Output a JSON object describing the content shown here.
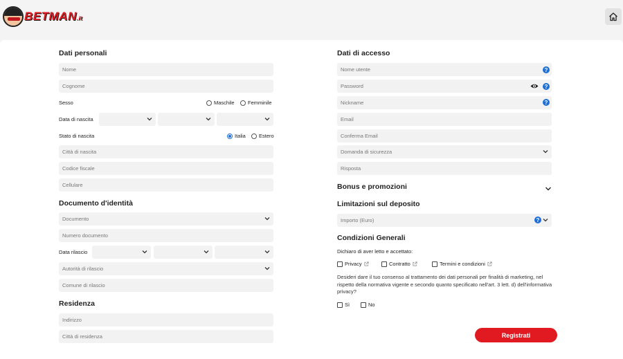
{
  "brand": {
    "name": "BETMAN",
    "suffix": ".it"
  },
  "left": {
    "personal_title": "Dati personali",
    "nome": "Nome",
    "cognome": "Cognome",
    "sesso_label": "Sesso",
    "sesso_options": [
      "Maschile",
      "Femminile"
    ],
    "data_nascita_label": "Data di nascita",
    "stato_nascita_label": "Stato di nascita",
    "stato_options": [
      "Italia",
      "Estero"
    ],
    "stato_selected": "Italia",
    "citta_nascita": "Città di nascita",
    "codice_fiscale": "Codice fiscale",
    "cellulare": "Cellulare",
    "documento_title": "Documento d'identità",
    "documento": "Documento",
    "numero_documento": "Numero documento",
    "data_rilascio_label": "Data rilascio",
    "autorita_rilascio": "Autorità di rilascio",
    "comune_rilascio": "Comune di rilascio",
    "residenza_title": "Residenza",
    "indirizzo": "Indirizzo",
    "citta_residenza": "Città di residenza"
  },
  "right": {
    "access_title": "Dati di accesso",
    "nome_utente": "Nome utente",
    "password": "Password",
    "nickname": "Nickname",
    "email": "Email",
    "conferma_email": "Conferma Email",
    "domanda_sicurezza": "Domanda di sicurezza",
    "risposta": "Risposta",
    "bonus_title": "Bonus e promozioni",
    "limitazioni_title": "Limitazioni sul deposito",
    "importo": "Importo (Euro)",
    "condizioni_title": "Condizioni Generali",
    "dichiaro": "Dichiaro di aver letto e accettato:",
    "privacy": "Privacy",
    "contratto": "Contratto",
    "termini": "Termini e condizioni",
    "consenso": "Desideri dare il tuo consenso al trattamento dei dati personali per finalità di marketing, nel rispetto della normativa vigente e secondo quanto specificato nell'art. 3 lett. d) dell'informativa privacy?",
    "si": "Sì",
    "no": "No",
    "registrati": "Registrati"
  },
  "icons": {
    "help": "help-circle-icon",
    "eye": "eye-icon",
    "home": "home-icon",
    "chevron": "chevron-down-icon",
    "external": "external-link-icon"
  },
  "colors": {
    "brand_red": "#e11a22",
    "help_blue": "#1d6fd6",
    "field_bg": "#f2f2f2"
  }
}
